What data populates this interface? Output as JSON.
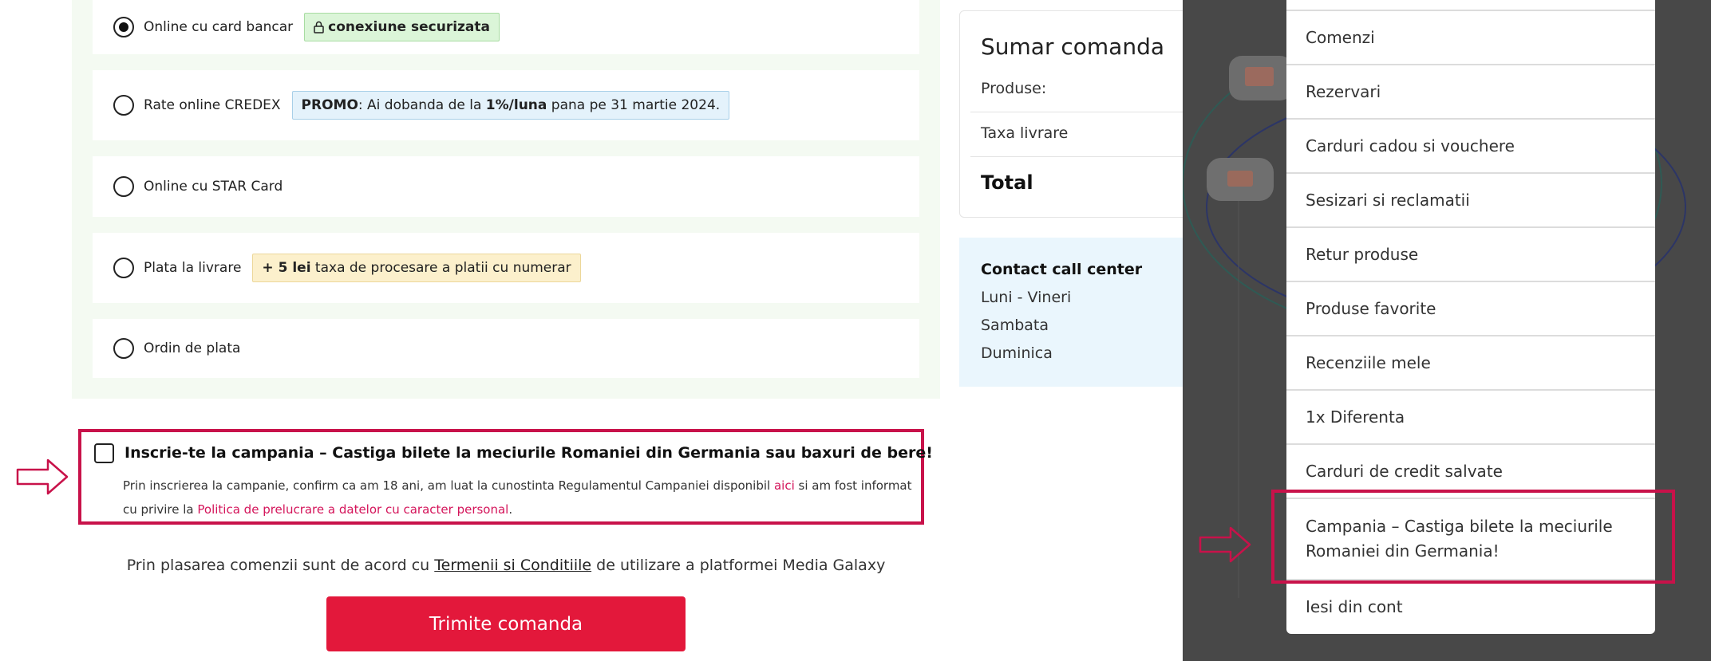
{
  "payment": {
    "options": [
      {
        "label": "Online cu card bancar",
        "selected": true,
        "badge": "conexiune securizata"
      },
      {
        "label": "Rate online CREDEX",
        "selected": false,
        "badge_strong": "PROMO",
        "badge_text_1": ": Ai dobanda de la ",
        "badge_strong_2": "1%/luna",
        "badge_text_2": " pana pe 31 martie 2024."
      },
      {
        "label": "Online cu STAR Card",
        "selected": false
      },
      {
        "label": "Plata la livrare",
        "selected": false,
        "badge_strong": "+ 5 lei",
        "badge_text": " taxa de procesare a platii cu numerar"
      },
      {
        "label": "Ordin de plata",
        "selected": false
      }
    ]
  },
  "campaign": {
    "checked": false,
    "title": "Inscrie-te la campania – Castiga bilete la meciurile Romaniei din Germania sau baxuri de bere!",
    "text_1": "Prin inscrierea la campanie, confirm ca am 18 ani, am luat la cunostinta Regulamentul Campaniei disponibil ",
    "link_1": "aici",
    "text_2": " si am fost informat cu privire la ",
    "link_2": "Politica de prelucrare a datelor cu caracter personal",
    "text_3": "."
  },
  "terms": {
    "before": "Prin plasarea comenzii sunt de acord cu ",
    "link": "Termenii si Conditiile",
    "after": " de utilizare a platformei Media Galaxy"
  },
  "submit_label": "Trimite comanda",
  "summary": {
    "title": "Sumar comanda",
    "products": "Produse:",
    "shipping": "Taxa livrare",
    "total": "Total"
  },
  "contact": {
    "title": "Contact call center",
    "days": [
      "Luni - Vineri",
      "Sambata",
      "Duminica"
    ]
  },
  "account_menu": {
    "items": [
      "Comenzi",
      "Rezervari",
      "Carduri cadou si vouchere",
      "Sesizari si reclamatii",
      "Retur produse",
      "Produse favorite",
      "Recenziile mele",
      "1x Diferenta",
      "Carduri de credit salvate",
      "Campania – Castiga bilete la meciurile Romaniei din Germania!",
      "Iesi din cont"
    ]
  },
  "colors": {
    "accent_red": "#e3183b",
    "highlight_border": "#c8124a",
    "link_pink": "#d4145a",
    "overlay": "#484848"
  }
}
